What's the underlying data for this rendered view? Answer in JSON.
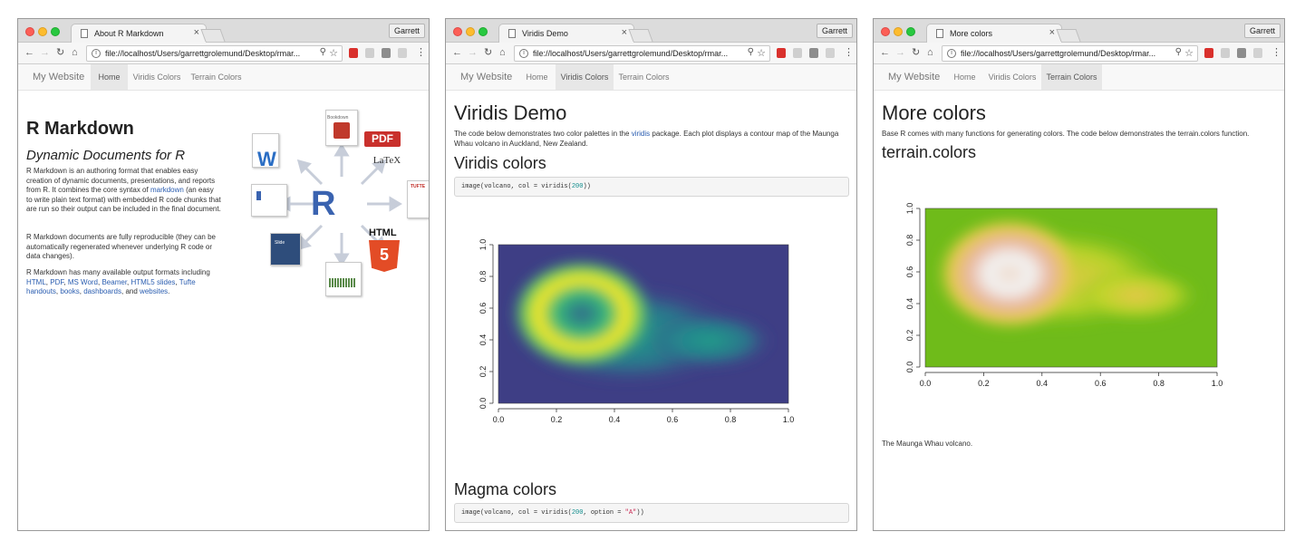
{
  "profile_name": "Garrett",
  "url": "file://localhost/Users/garrettgrolemund/Desktop/rmar...",
  "brand": "My Website",
  "nav_items": [
    "Home",
    "Viridis Colors",
    "Terrain Colors"
  ],
  "windows": [
    {
      "tab_title": "About R Markdown",
      "active_nav": "Home",
      "heading": "R Markdown",
      "subheading": "Dynamic Documents for R",
      "p1_before_link": "R Markdown is an authoring format that enables easy creation of dynamic documents, presentations, and reports from R. It combines the core syntax of",
      "p1_link": "markdown",
      "p1_after_link": "(an easy to write plain text format) with embedded R code chunks that are run so their output can be included in the final document.",
      "p2": "R Markdown documents are fully reproducible (they can be automatically regenerated whenever underlying R code or data changes).",
      "p3_intro": "R Markdown has many available output formats including",
      "p3_links": [
        "HTML",
        "PDF",
        "MS Word",
        "Beamer",
        "HTML5 slides",
        "Tufte handouts",
        "books",
        "dashboards",
        "websites"
      ],
      "p3_and": "and",
      "diagram": {
        "center": "R",
        "pdf": "PDF",
        "latex": "LaTeX",
        "html5": "HTML",
        "html5_badge": "5",
        "word": "W",
        "tufte": "TUFTE",
        "bookdown": "Bookdown",
        "slide": "Slide"
      }
    },
    {
      "tab_title": "Viridis Demo",
      "active_nav": "Viridis Colors",
      "heading": "Viridis Demo",
      "intro_before": "The code below demonstrates two color palettes in the",
      "intro_link": "viridis",
      "intro_after": "package. Each plot displays a contour map of the Maunga Whau volcano in Auckland, New Zealand.",
      "section1": "Viridis colors",
      "code1": {
        "fn": "image(volcano, col = viridis(",
        "n": "200",
        "end": "))"
      },
      "section2": "Magma colors",
      "code2": {
        "fn": "image(volcano, col = viridis(",
        "n": "200",
        "mid": ", option = ",
        "opt": "\"A\"",
        "end": "))"
      }
    },
    {
      "tab_title": "More colors",
      "active_nav": "Terrain Colors",
      "heading": "More colors",
      "intro": "Base R comes with many functions for generating colors. The code below demonstrates the terrain.colors function.",
      "section1": "terrain.colors",
      "caption": "The Maunga Whau volcano."
    }
  ],
  "icons": {
    "back": "←",
    "forward": "→",
    "reload": "↻",
    "home": "⌂",
    "zoom": "⚲",
    "star": "☆",
    "menu": "⋮",
    "close": "×",
    "info": "i"
  },
  "chart_data": [
    {
      "type": "heatmap",
      "palette": "viridis",
      "x": [
        0.0,
        0.2,
        0.4,
        0.6,
        0.8,
        1.0
      ],
      "y": [
        0.0,
        0.2,
        0.4,
        0.6,
        0.8,
        1.0
      ],
      "xlim": [
        0,
        1
      ],
      "ylim": [
        0,
        1
      ],
      "x_ticks": [
        "0.0",
        "0.2",
        "0.4",
        "0.6",
        "0.8",
        "1.0"
      ],
      "y_ticks": [
        "0.0",
        "0.2",
        "0.4",
        "0.6",
        "0.8",
        "1.0"
      ],
      "title": "",
      "xlabel": "",
      "ylabel": ""
    },
    {
      "type": "heatmap",
      "palette": "terrain.colors",
      "x": [
        0.0,
        0.2,
        0.4,
        0.6,
        0.8,
        1.0
      ],
      "y": [
        0.0,
        0.2,
        0.4,
        0.6,
        0.8,
        1.0
      ],
      "xlim": [
        0,
        1
      ],
      "ylim": [
        0,
        1
      ],
      "x_ticks": [
        "0.0",
        "0.2",
        "0.4",
        "0.6",
        "0.8",
        "1.0"
      ],
      "y_ticks": [
        "0.0",
        "0.2",
        "0.4",
        "0.6",
        "0.8",
        "1.0"
      ],
      "title": "",
      "xlabel": "",
      "ylabel": ""
    }
  ]
}
